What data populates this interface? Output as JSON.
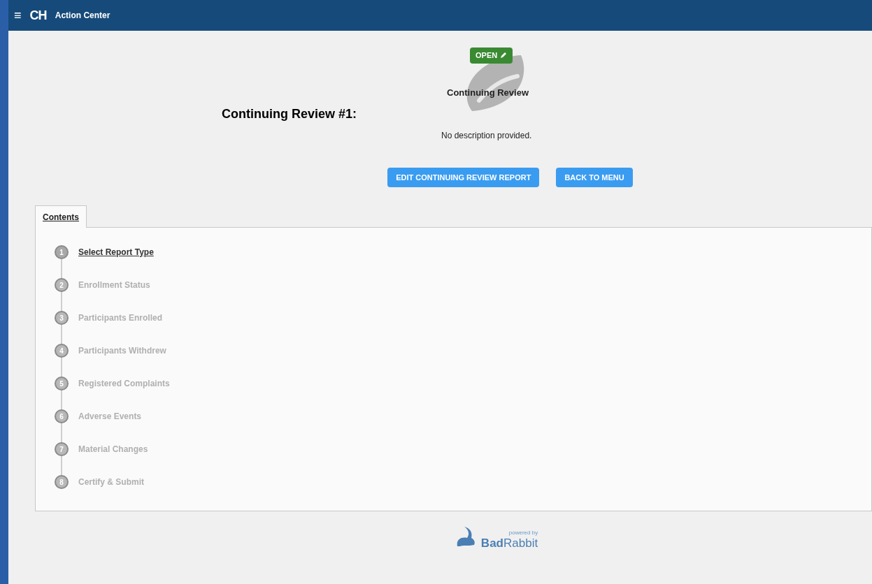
{
  "header": {
    "menu_glyph": "≡",
    "logo": "CH",
    "title": "Action Center"
  },
  "status_badge": {
    "label": "OPEN"
  },
  "type_label": "Continuing Review",
  "title": "Continuing Review #1:",
  "description": "No description provided.",
  "buttons": [
    "EDIT CONTINUING REVIEW REPORT",
    "BACK TO MENU"
  ],
  "tabs": [
    {
      "label": "Contents",
      "selected": true
    }
  ],
  "steps": [
    {
      "number": "1",
      "label": "Select Report Type",
      "selected": true
    },
    {
      "number": "2",
      "label": "Enrollment Status",
      "selected": false
    },
    {
      "number": "3",
      "label": "Participants Enrolled",
      "selected": false
    },
    {
      "number": "4",
      "label": "Participants Withdrew",
      "selected": false
    },
    {
      "number": "5",
      "label": "Registered Complaints",
      "selected": false
    },
    {
      "number": "6",
      "label": "Adverse Events",
      "selected": false
    },
    {
      "number": "7",
      "label": "Material Changes",
      "selected": false
    },
    {
      "number": "8",
      "label": "Certify & Submit",
      "selected": false
    }
  ],
  "footer": {
    "powered": "powered by",
    "brand_a": "Bad",
    "brand_b": "Rabbit"
  }
}
